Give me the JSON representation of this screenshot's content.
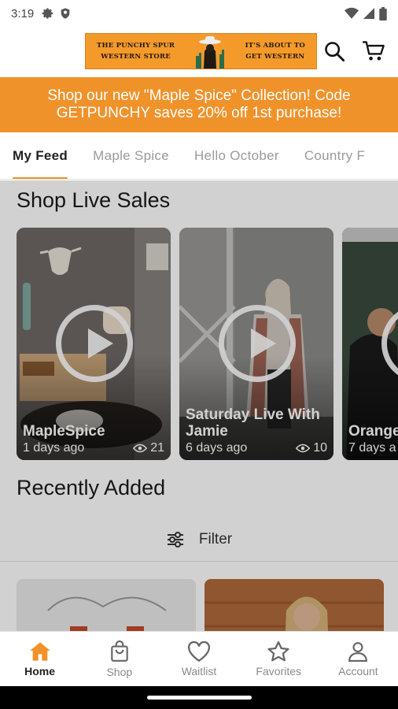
{
  "status_bar": {
    "time": "3:19"
  },
  "header": {
    "logo_left": "THE PUNCHY SPUR\nWESTERN STORE",
    "logo_right": "IT'S ABOUT TO\nGET WESTERN"
  },
  "promo": {
    "text": "Shop our new \"Maple Spice\" Collection! Code GETPUNCHY saves 20% off 1st purchase!"
  },
  "tabs": [
    "My Feed",
    "Maple Spice",
    "Hello October",
    "Country F"
  ],
  "live_sales": {
    "title": "Shop Live Sales",
    "cards": [
      {
        "title": "MapleSpice",
        "age": "1 days ago",
        "views": "21"
      },
      {
        "title": "Saturday Live With Jamie",
        "age": "6 days ago",
        "views": "10"
      },
      {
        "title": "Orange black",
        "age": "7 days a",
        "views": ""
      }
    ]
  },
  "recent": {
    "title": "Recently Added",
    "filter_label": "Filter"
  },
  "bottom_nav": {
    "items": [
      {
        "label": "Home",
        "icon": "home-icon"
      },
      {
        "label": "Shop",
        "icon": "shopping-bag-icon"
      },
      {
        "label": "Waitlist",
        "icon": "heart-icon"
      },
      {
        "label": "Favorites",
        "icon": "star-icon"
      },
      {
        "label": "Account",
        "icon": "person-icon"
      }
    ]
  },
  "colors": {
    "accent": "#f0922a",
    "logo_bg": "#f39a2b"
  }
}
